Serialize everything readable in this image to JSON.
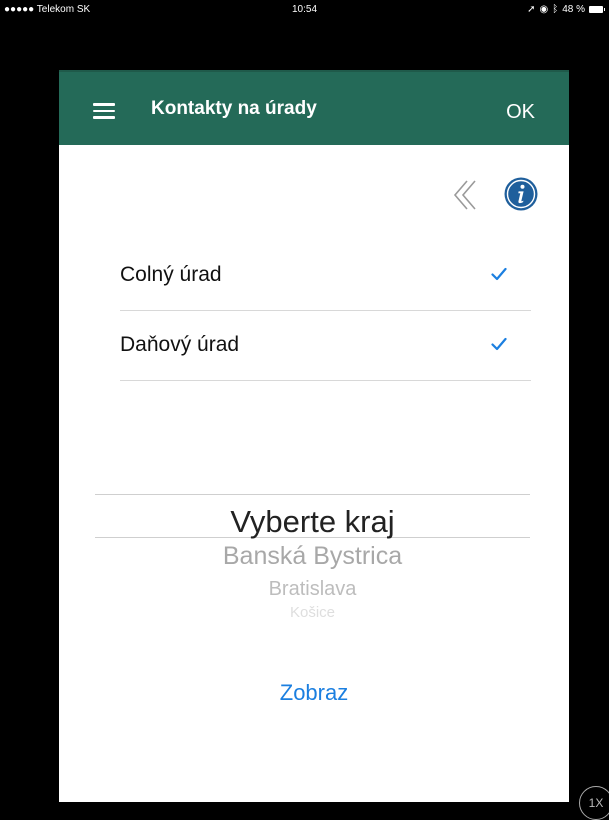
{
  "status_bar": {
    "carrier": "●●●●● Telekom SK",
    "time": "10:54",
    "battery": "48 %"
  },
  "navbar": {
    "title": "Kontakty na úrady",
    "ok_label": "OK",
    "background_color": "#246a58"
  },
  "toolbar": {
    "back_icon": "chevron-double-left-icon",
    "info_icon": "info-icon"
  },
  "offices": [
    {
      "label": "Colný úrad",
      "checked": true
    },
    {
      "label": "Daňový úrad",
      "checked": true
    }
  ],
  "region_picker": {
    "selected": "Vyberte kraj",
    "options": [
      "Banská Bystrica",
      "Bratislava",
      "Košice"
    ]
  },
  "show_button_label": "Zobraz",
  "zoom_badge": "1X",
  "colors": {
    "accent": "#1b7fe0",
    "info": "#1f5f9c"
  }
}
